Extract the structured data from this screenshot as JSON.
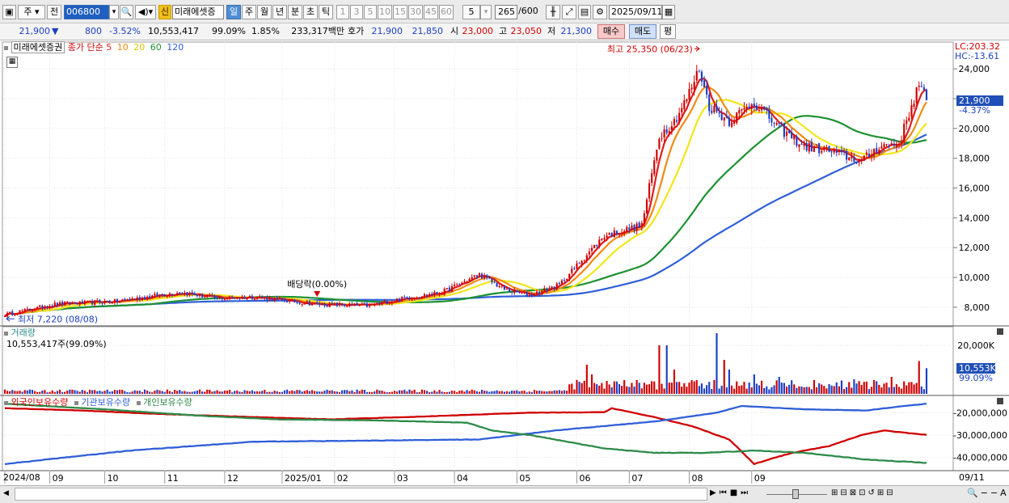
{
  "toolbar": {
    "market": "주",
    "prev": "전",
    "code": "006800",
    "credit_badge": "신",
    "name": "미래에셋증",
    "periods": [
      "일",
      "주",
      "월",
      "년",
      "분",
      "초",
      "틱"
    ],
    "active_period": "일",
    "intervals": [
      "1",
      "3",
      "5",
      "10",
      "15",
      "30",
      "45",
      "60"
    ],
    "interval_value": "5",
    "count": "265",
    "count_total": "/600",
    "date": "2025/09/11"
  },
  "quote": {
    "price": "21,900",
    "change": "800",
    "change_pct": "-3.52%",
    "volume": "10,553,417",
    "vol_ratio": "99.09%",
    "turnover": "1.85%",
    "amount": "233,317백만",
    "bid_label": "호가",
    "ask": "21,900",
    "bid": "21,850",
    "open_label": "시",
    "open": "23,000",
    "high_label": "고",
    "high": "23,050",
    "low_label": "저",
    "low": "21,300",
    "buy_label": "매수",
    "sell_label": "매도",
    "eval_label": "평"
  },
  "colors": {
    "up": "#d00000",
    "down": "#1b3fc4",
    "ma5": "#e11b1b",
    "ma10": "#ef8b14",
    "ma20": "#f3e61a",
    "ma60": "#1d9131",
    "ma120": "#2f5fd8",
    "foreign": "#d00000",
    "institution": "#2f5fd8",
    "individual": "#2e8b4a"
  },
  "chart_data": [
    {
      "type": "candlestick",
      "legend": {
        "name": "미래에셋증권",
        "kind": "종가 단순",
        "mas": [
          "5",
          "10",
          "20",
          "60",
          "120"
        ]
      },
      "y_ticks": [
        "24,000",
        "22,000",
        "20,000",
        "18,000",
        "16,000",
        "14,000",
        "12,000",
        "10,000",
        "8,000"
      ],
      "ylim": [
        6800,
        25800
      ],
      "lc_label": "LC:203.32",
      "hc_label": "HC:-13.61",
      "current_label": "21,900",
      "current_pct": "-4.37%",
      "current_value": 21900,
      "max_annotation": "최고 25,350 (06/23)",
      "max_value": 25350,
      "min_annotation": "최저 7,220 (08/08)",
      "min_value": 7220,
      "dividend_annotation": "배당락(0.00%)",
      "price_keypoints": [
        [
          0,
          7500
        ],
        [
          20,
          8200
        ],
        [
          45,
          8400
        ],
        [
          70,
          9000
        ],
        [
          85,
          8600
        ],
        [
          100,
          8700
        ],
        [
          125,
          8200
        ],
        [
          145,
          8100
        ],
        [
          160,
          8600
        ],
        [
          175,
          9000
        ],
        [
          190,
          10200
        ],
        [
          200,
          9200
        ],
        [
          210,
          8800
        ],
        [
          222,
          9500
        ],
        [
          230,
          11000
        ],
        [
          240,
          12800
        ],
        [
          255,
          13500
        ],
        [
          262,
          19500
        ],
        [
          268,
          20500
        ],
        [
          273,
          22000
        ],
        [
          278,
          24000
        ],
        [
          282,
          21500
        ],
        [
          290,
          20500
        ],
        [
          300,
          21800
        ],
        [
          310,
          20000
        ],
        [
          320,
          18800
        ],
        [
          330,
          18500
        ],
        [
          343,
          17800
        ],
        [
          350,
          18800
        ],
        [
          358,
          19000
        ],
        [
          366,
          23000
        ],
        [
          369,
          21900
        ]
      ],
      "n_days": 370
    },
    {
      "type": "bar",
      "title": "거래량",
      "volume_label": "10,553,417주(99.09%)",
      "y_ticks": [
        "20,000K"
      ],
      "ylim": [
        0,
        27000000
      ],
      "current_label": "10,553K",
      "current_pct": "99.09%",
      "current_value": 10553417,
      "spikes": [
        [
          233,
          12000000
        ],
        [
          235,
          8000000
        ],
        [
          262,
          20000000
        ],
        [
          265,
          20000000
        ],
        [
          268,
          10000000
        ],
        [
          285,
          25000000
        ],
        [
          288,
          14000000
        ],
        [
          290,
          10000000
        ],
        [
          300,
          8000000
        ],
        [
          310,
          7000000
        ],
        [
          340,
          6000000
        ],
        [
          355,
          7000000
        ],
        [
          366,
          13500000
        ],
        [
          369,
          10553417
        ]
      ]
    },
    {
      "type": "line",
      "series": [
        {
          "name": "외국인보유수량",
          "color": "#d00000",
          "keypoints": [
            [
              0,
              -18000000
            ],
            [
              30,
              -19000000
            ],
            [
              60,
              -20500000
            ],
            [
              100,
              -22000000
            ],
            [
              130,
              -23000000
            ],
            [
              160,
              -22000000
            ],
            [
              210,
              -20000000
            ],
            [
              240,
              -19800000
            ],
            [
              243,
              -18000000
            ],
            [
              260,
              -22000000
            ],
            [
              275,
              -26000000
            ],
            [
              290,
              -32000000
            ],
            [
              300,
              -43000000
            ],
            [
              315,
              -38000000
            ],
            [
              330,
              -35000000
            ],
            [
              343,
              -30000000
            ],
            [
              352,
              -28000000
            ],
            [
              369,
              -30000000
            ]
          ]
        },
        {
          "name": "기관보유수량",
          "color": "#2f5fd8",
          "keypoints": [
            [
              0,
              -43000000
            ],
            [
              50,
              -37000000
            ],
            [
              100,
              -33000000
            ],
            [
              150,
              -32500000
            ],
            [
              190,
              -32000000
            ],
            [
              220,
              -28000000
            ],
            [
              260,
              -24000000
            ],
            [
              285,
              -20000000
            ],
            [
              295,
              -17000000
            ],
            [
              320,
              -18500000
            ],
            [
              345,
              -19000000
            ],
            [
              360,
              -17000000
            ],
            [
              369,
              -16000000
            ]
          ]
        },
        {
          "name": "개인보유수량",
          "color": "#2e8b4a",
          "keypoints": [
            [
              0,
              -16000000
            ],
            [
              40,
              -18500000
            ],
            [
              80,
              -21500000
            ],
            [
              110,
              -23000000
            ],
            [
              150,
              -23500000
            ],
            [
              185,
              -24500000
            ],
            [
              195,
              -28000000
            ],
            [
              210,
              -30000000
            ],
            [
              240,
              -36000000
            ],
            [
              260,
              -38000000
            ],
            [
              280,
              -38000000
            ],
            [
              300,
              -37000000
            ],
            [
              320,
              -38000000
            ],
            [
              345,
              -41000000
            ],
            [
              369,
              -42500000
            ]
          ]
        }
      ],
      "y_ticks": [
        "-20,000,000",
        "-30,000,000",
        "-40,000,000"
      ],
      "ylim": [
        -46000000,
        -13000000
      ]
    }
  ],
  "x_axis": {
    "labels": [
      [
        "2024/08",
        0
      ],
      [
        "09",
        18
      ],
      [
        "10",
        40
      ],
      [
        "11",
        64
      ],
      [
        "12",
        88
      ],
      [
        "2025/01",
        111
      ],
      [
        "02",
        132
      ],
      [
        "03",
        156
      ],
      [
        "04",
        180
      ],
      [
        "05",
        205
      ],
      [
        "06",
        229
      ],
      [
        "07",
        250
      ],
      [
        "08",
        274
      ],
      [
        "09",
        299
      ]
    ],
    "last_label": "09/11",
    "n_days": 370
  }
}
